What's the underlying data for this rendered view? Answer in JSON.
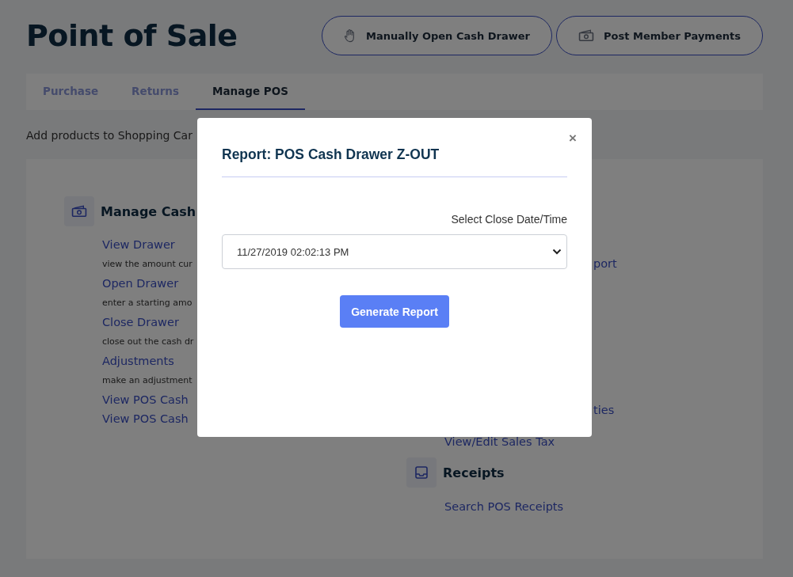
{
  "page": {
    "title": "Point of Sale"
  },
  "header_buttons": [
    {
      "label": "Manually Open Cash Drawer"
    },
    {
      "label": "Post Member Payments"
    }
  ],
  "tabs": [
    {
      "label": "Purchase",
      "selected": false
    },
    {
      "label": "Returns",
      "selected": false
    },
    {
      "label": "Manage POS",
      "selected": true
    }
  ],
  "intro": "Add products to Shopping Car",
  "cash_section": {
    "heading": "Manage Cash",
    "items": [
      {
        "kind": "link",
        "text": "View Drawer"
      },
      {
        "kind": "description",
        "text": "view the amount cur"
      },
      {
        "kind": "link",
        "text": "Open Drawer"
      },
      {
        "kind": "description",
        "text": "enter a starting amo"
      },
      {
        "kind": "link",
        "text": "Close Drawer"
      },
      {
        "kind": "description",
        "text": "close out the cash dr"
      },
      {
        "kind": "link",
        "text": "Adjustments"
      },
      {
        "kind": "description",
        "text": "make an adjustment"
      },
      {
        "kind": "link",
        "text": "View POS Cash"
      },
      {
        "kind": "link",
        "text": "View POS Cash"
      }
    ]
  },
  "right_links": [
    {
      "text": "port"
    },
    {
      "text": "ties"
    },
    {
      "text": "View/Edit Sales Tax"
    }
  ],
  "receipts_section": {
    "heading": "Receipts",
    "links": [
      "Search POS Receipts"
    ]
  },
  "modal": {
    "title": "Report: POS Cash Drawer Z-OUT",
    "close": "×",
    "label": "Select Close Date/Time",
    "value": "11/27/2019 02:02:13 PM",
    "button": "Generate Report"
  }
}
